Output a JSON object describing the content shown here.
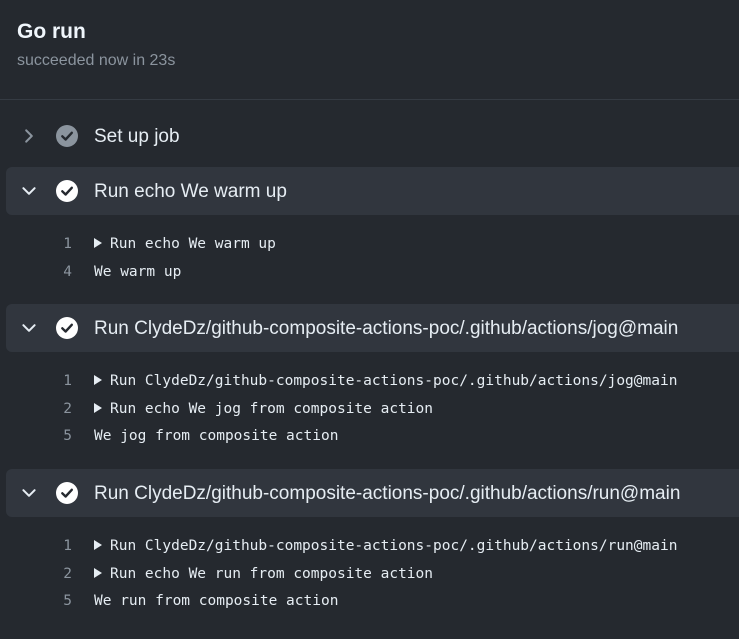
{
  "job": {
    "title": "Go run",
    "status": "succeeded now in 23s"
  },
  "steps": [
    {
      "name": "Set up job",
      "expanded": false,
      "lines": []
    },
    {
      "name": "Run echo We warm up",
      "expanded": true,
      "lines": [
        {
          "no": "1",
          "text": "Run echo We warm up",
          "group": true
        },
        {
          "no": "4",
          "text": "We warm up",
          "group": false
        }
      ]
    },
    {
      "name": "Run ClydeDz/github-composite-actions-poc/.github/actions/jog@main",
      "expanded": true,
      "lines": [
        {
          "no": "1",
          "text": "Run ClydeDz/github-composite-actions-poc/.github/actions/jog@main",
          "group": true
        },
        {
          "no": "2",
          "text": "Run echo We jog from composite action",
          "group": true
        },
        {
          "no": "5",
          "text": "We jog from composite action",
          "group": false
        }
      ]
    },
    {
      "name": "Run ClydeDz/github-composite-actions-poc/.github/actions/run@main",
      "expanded": true,
      "lines": [
        {
          "no": "1",
          "text": "Run ClydeDz/github-composite-actions-poc/.github/actions/run@main",
          "group": true
        },
        {
          "no": "2",
          "text": "Run echo We run from composite action",
          "group": true
        },
        {
          "no": "5",
          "text": "We run from composite action",
          "group": false
        }
      ]
    }
  ],
  "colors": {
    "background": "#25292f",
    "expanded_header": "#31363e",
    "check_expanded": "#ffffff",
    "check_collapsed": "#8b949e",
    "muted_text": "#8b949e"
  }
}
